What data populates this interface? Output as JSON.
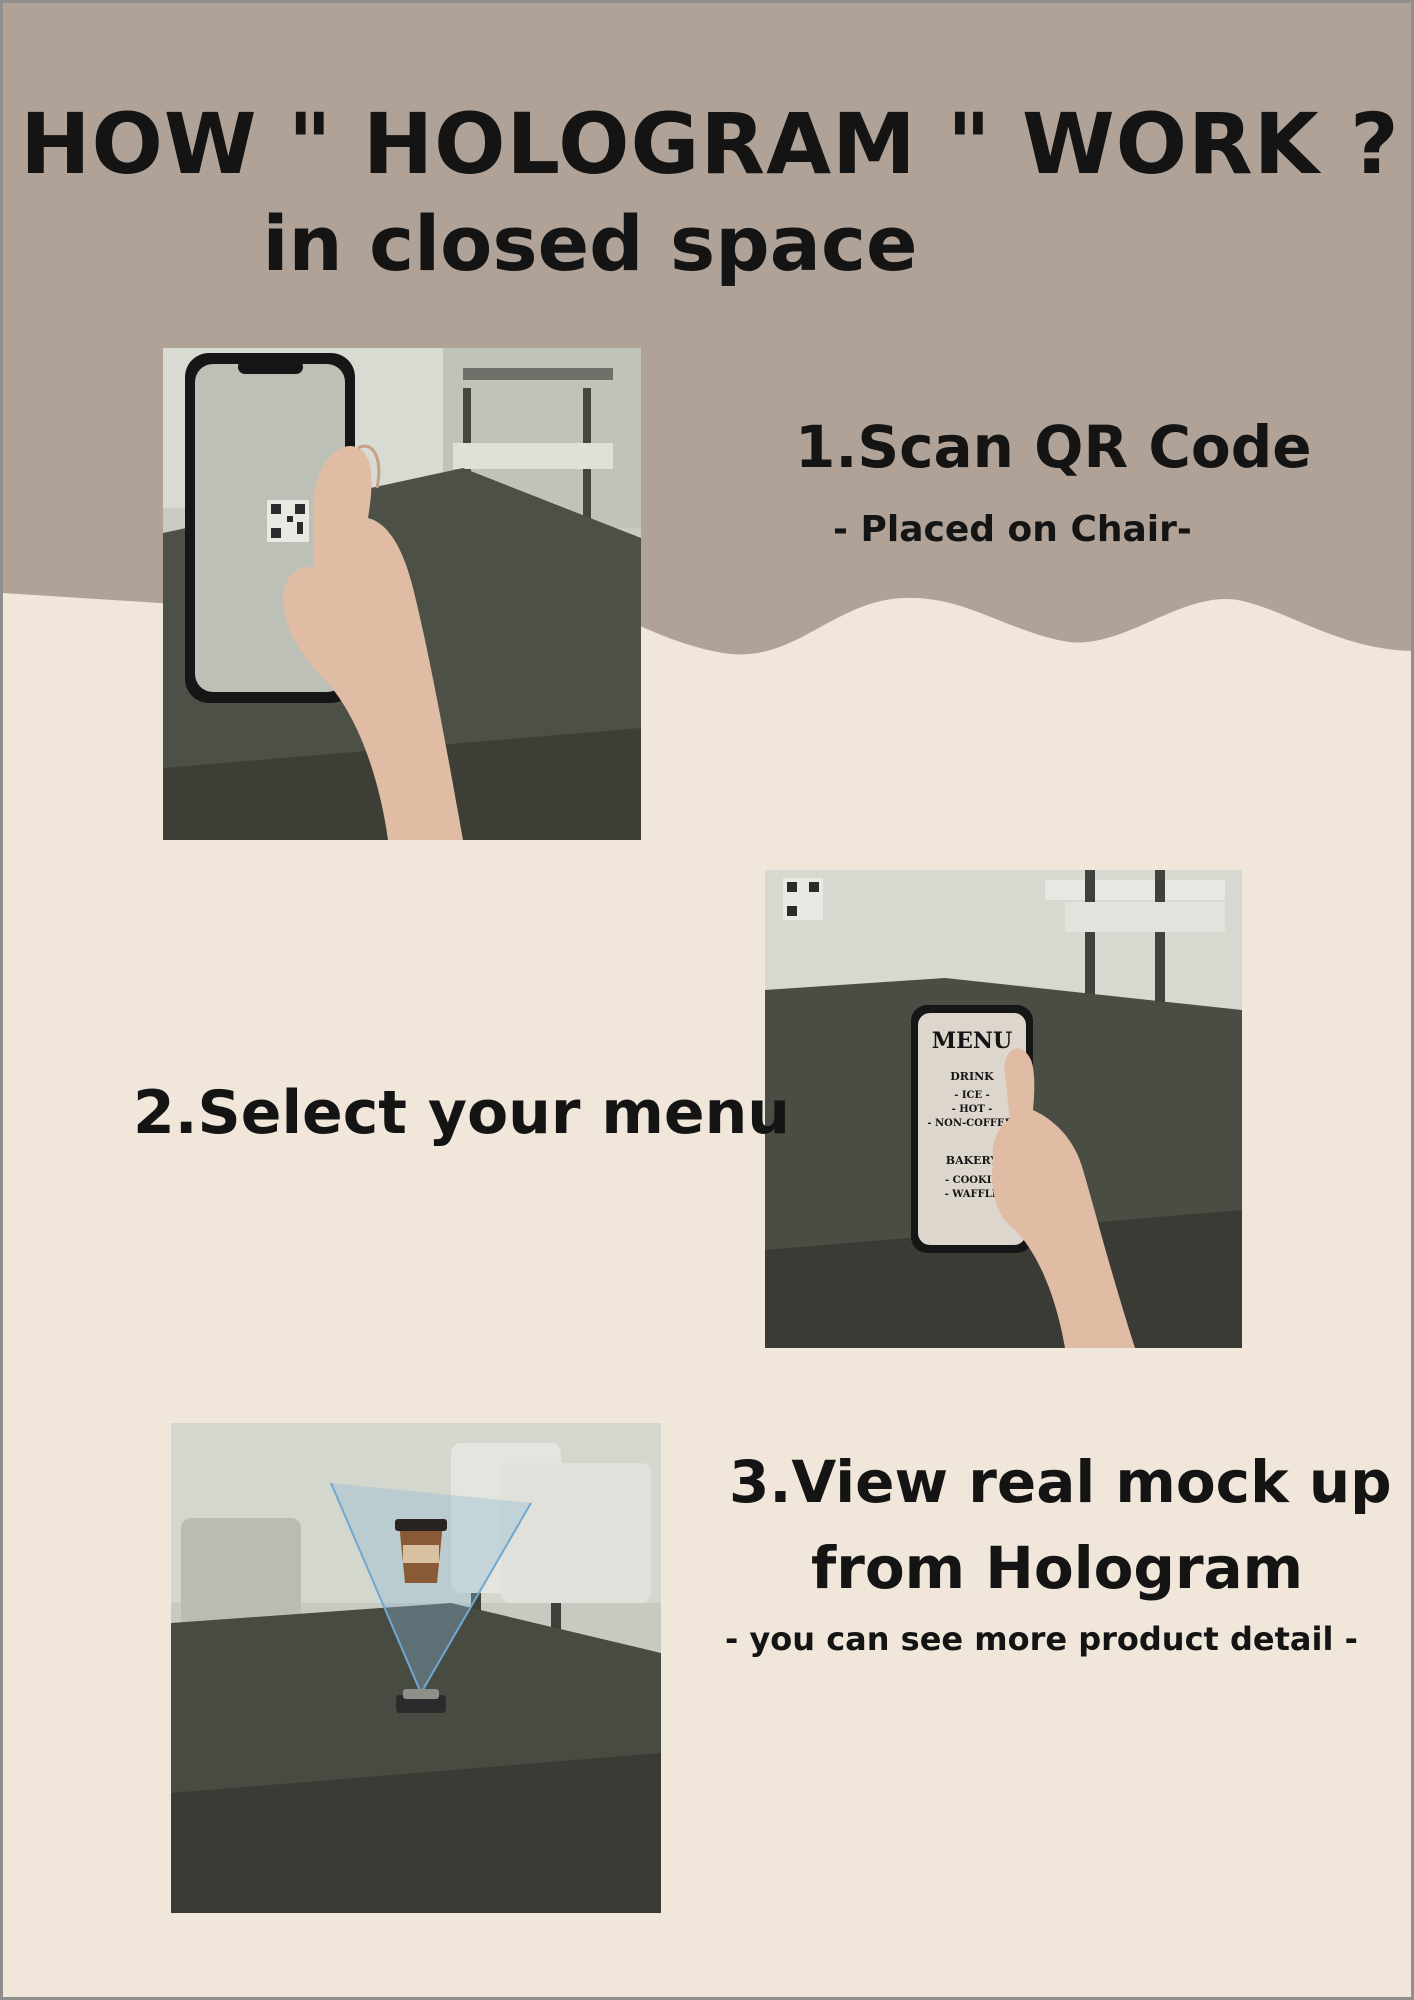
{
  "poster": {
    "title": "HOW \" HOLOGRAM \" WORK ?",
    "subtitle": "in closed space",
    "colors": {
      "top_band": "#b0a296",
      "background": "#f0e6da",
      "text": "#141414"
    }
  },
  "steps": [
    {
      "title": "1.Scan QR Code",
      "note": "- Placed on Chair-"
    },
    {
      "title": "2.Select your menu",
      "note": ""
    },
    {
      "title_line1": "3.View real mock up",
      "title_line2": "from Hologram",
      "note": "- you can see more product detail -"
    }
  ],
  "menu_screen": {
    "heading": "MENU",
    "section1": "DRINK",
    "items1": [
      "- ICE -",
      "- HOT -",
      "- NON-COFFEE-"
    ],
    "section2": "BAKERY",
    "items2": [
      "- COOKIE",
      "- WAFFLE"
    ]
  }
}
